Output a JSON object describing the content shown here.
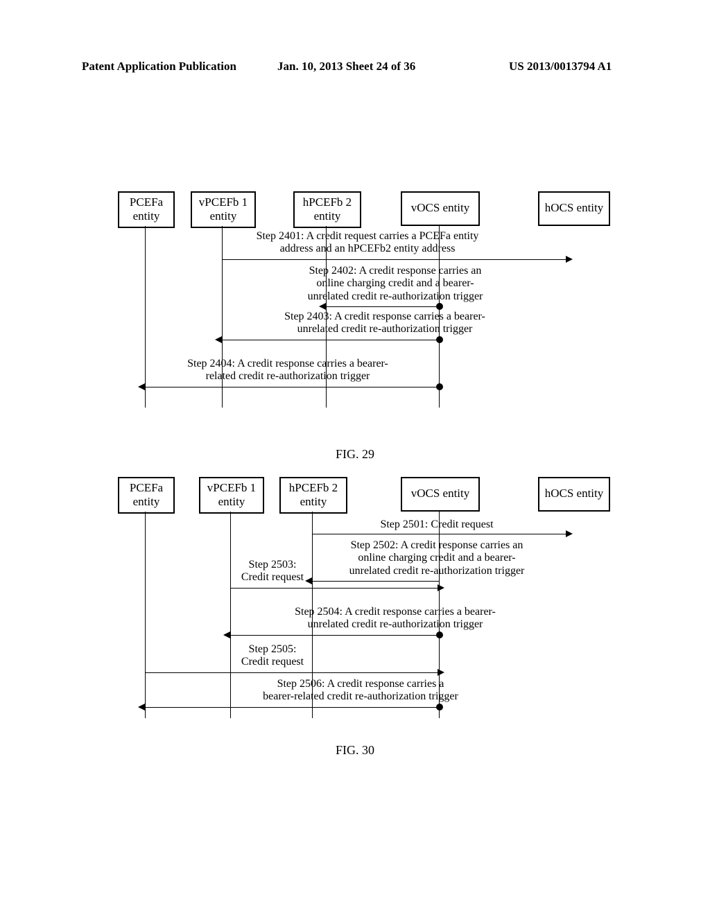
{
  "header": {
    "left": "Patent Application Publication",
    "center": "Jan. 10, 2013  Sheet 24 of 36",
    "right": "US 2013/0013794 A1"
  },
  "fig29": {
    "entities": {
      "pcefa": "PCEFa\nentity",
      "vpcefb1": "vPCEFb 1\nentity",
      "hpcefb2": "hPCEFb 2\nentity",
      "vocs": "vOCS entity",
      "hocs": "hOCS entity"
    },
    "steps": {
      "s2401": "Step 2401: A credit request carries a PCEFa entity\naddress and an hPCEFb2 entity address",
      "s2402": "Step 2402: A credit response carries an\nonline charging credit and a bearer-\nunrelated credit re-authorization trigger",
      "s2403": "Step 2403: A credit response carries a bearer-\nunrelated credit re-authorization trigger",
      "s2404": "Step 2404: A credit response carries a bearer-\nrelated credit re-authorization trigger"
    },
    "label": "FIG. 29"
  },
  "fig30": {
    "entities": {
      "pcefa": "PCEFa\nentity",
      "vpcefb1": "vPCEFb 1\nentity",
      "hpcefb2": "hPCEFb 2\nentity",
      "vocs": "vOCS entity",
      "hocs": "hOCS entity"
    },
    "steps": {
      "s2501": "Step 2501: Credit request",
      "s2502": "Step 2502: A credit response carries an\nonline charging credit and a bearer-\nunrelated credit re-authorization trigger",
      "s2503": "Step 2503:\nCredit request",
      "s2504": "Step 2504: A credit response carries a bearer-\nunrelated credit re-authorization trigger",
      "s2505": "Step 2505:\nCredit request",
      "s2506": "Step 2506: A credit response carries a\nbearer-related credit re-authorization trigger"
    },
    "label": "FIG. 30"
  }
}
